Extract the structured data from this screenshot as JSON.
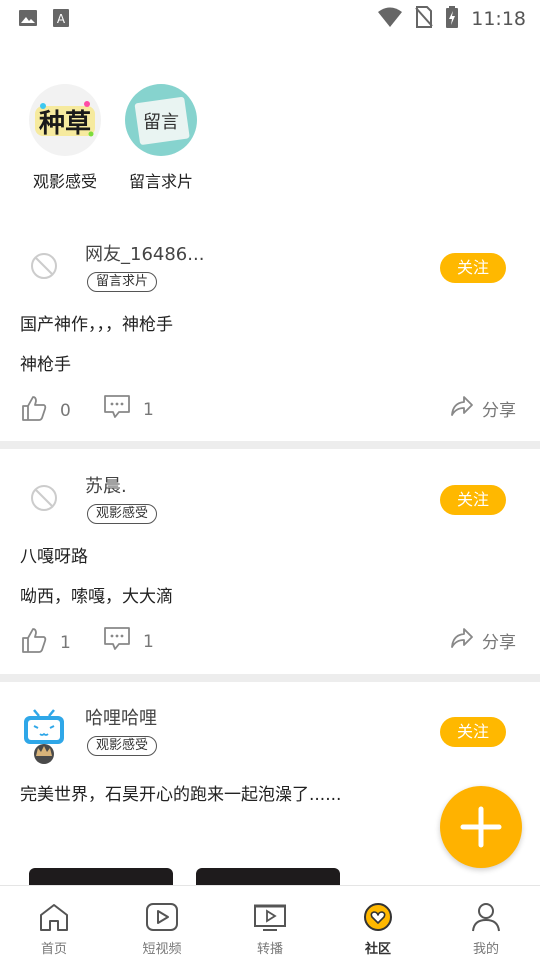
{
  "status_bar": {
    "time": "11:18"
  },
  "topics": [
    {
      "label": "观影感受",
      "image_text": "种草",
      "image_colors": [
        "#f4f4f4",
        "#1a1a1a"
      ]
    },
    {
      "label": "留言求片",
      "image_text": "留言",
      "image_colors": [
        "#7fcfc9",
        "#ffffff"
      ]
    }
  ],
  "posts": [
    {
      "username": "网友_16486...",
      "tag": "留言求片",
      "follow_label": "关注",
      "lines": [
        "国产神作，，，神枪手",
        "神枪手"
      ],
      "likes": "0",
      "comments": "1",
      "share_label": "分享"
    },
    {
      "username": "苏晨.",
      "tag": "观影感受",
      "follow_label": "关注",
      "lines": [
        "八嘎呀路",
        "呦西，嗦嘎，大大滴"
      ],
      "likes": "1",
      "comments": "1",
      "share_label": "分享"
    },
    {
      "username": "哈哩哈哩",
      "tag": "观影感受",
      "follow_label": "关注",
      "lines": [
        "完美世界，石昊开心的跑来一起泡澡了......"
      ]
    }
  ],
  "tabbar": {
    "items": [
      {
        "label": "首页",
        "icon": "home-icon"
      },
      {
        "label": "短视频",
        "icon": "play-icon"
      },
      {
        "label": "转播",
        "icon": "tv-icon"
      },
      {
        "label": "社区",
        "icon": "community-icon",
        "active": true
      },
      {
        "label": "我的",
        "icon": "profile-icon"
      }
    ]
  },
  "colors": {
    "accent": "#ffb800",
    "divider": "#ededed"
  }
}
